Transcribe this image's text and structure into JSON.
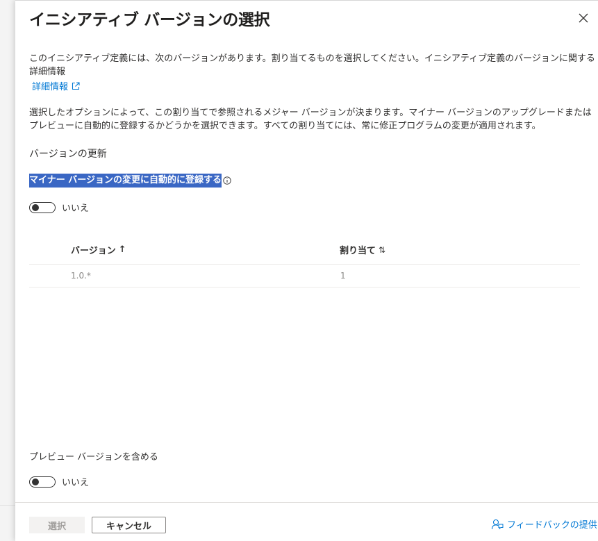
{
  "panel": {
    "title": "イニシアティブ バージョンの選択",
    "description": "このイニシアティブ定義には、次のバージョンがあります。割り当てるものを選択してください。イニシアティブ定義のバージョンに関する詳細情報",
    "learn_more_label": "詳細情報",
    "option_description": "選択したオプションによって、この割り当てで参照されるメジャー バージョンが決まります。マイナー バージョンのアップグレードまたはプレビューに自動的に登録するかどうかを選択できます。すべての割り当てには、常に修正プログラムの変更が適用されます。",
    "version_update_label": "バージョンの更新",
    "minor_version_label": "マイナー バージョンの変更に自動的に登録する",
    "minor_toggle_text": "いいえ",
    "preview_label": "プレビュー バージョンを含める",
    "preview_toggle_text": "いいえ"
  },
  "grid": {
    "columns": [
      {
        "label": "バージョン",
        "sort_glyph": "↑"
      },
      {
        "label": "割り当て",
        "sort_glyph": "⇅"
      }
    ],
    "rows": [
      {
        "version": "1.0.*",
        "assignments": "1"
      }
    ]
  },
  "footer": {
    "select_label": "選択",
    "cancel_label": "キャンセル",
    "feedback_label": "フィードバックの提供"
  }
}
